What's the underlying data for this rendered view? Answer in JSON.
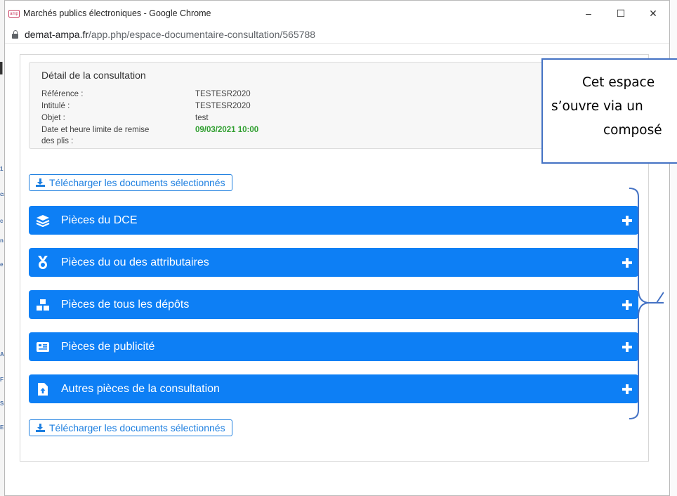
{
  "window": {
    "favicon": "amp",
    "title": "Marchés publics électroniques - Google Chrome",
    "controls": {
      "minimize": "–",
      "maximize": "☐",
      "close": "✕"
    }
  },
  "address": {
    "host": "demat-ampa.fr",
    "path": "/app.php/espace-documentaire-consultation/565788"
  },
  "detail": {
    "title": "Détail de la consultation",
    "rows": [
      {
        "label": "Référence :",
        "value": "TESTESR2020"
      },
      {
        "label": "Intitulé :",
        "value": "TESTESR2020"
      },
      {
        "label": "Objet :",
        "value": "test"
      },
      {
        "label": "Date et heure limite de remise",
        "label2": "des plis :",
        "value": "09/03/2021 10:00"
      }
    ]
  },
  "download_label": "Télécharger les documents sélectionnés",
  "sections": [
    {
      "label": "Pièces du DCE",
      "icon": "layers-icon"
    },
    {
      "label": "Pièces du ou des attributaires",
      "icon": "medal-icon"
    },
    {
      "label": "Pièces de tous les dépôts",
      "icon": "boxes-icon"
    },
    {
      "label": "Pièces de publicité",
      "icon": "newspaper-icon"
    },
    {
      "label": "Autres pièces de la consultation",
      "icon": "file-upload-icon"
    }
  ],
  "callout": {
    "lines": [
      "Cet espace",
      "s’ouvre via un",
      "composé"
    ]
  },
  "colors": {
    "accent": "#0d7ff5",
    "date_green": "#2e9e2e",
    "callout_border": "#4472c4"
  }
}
